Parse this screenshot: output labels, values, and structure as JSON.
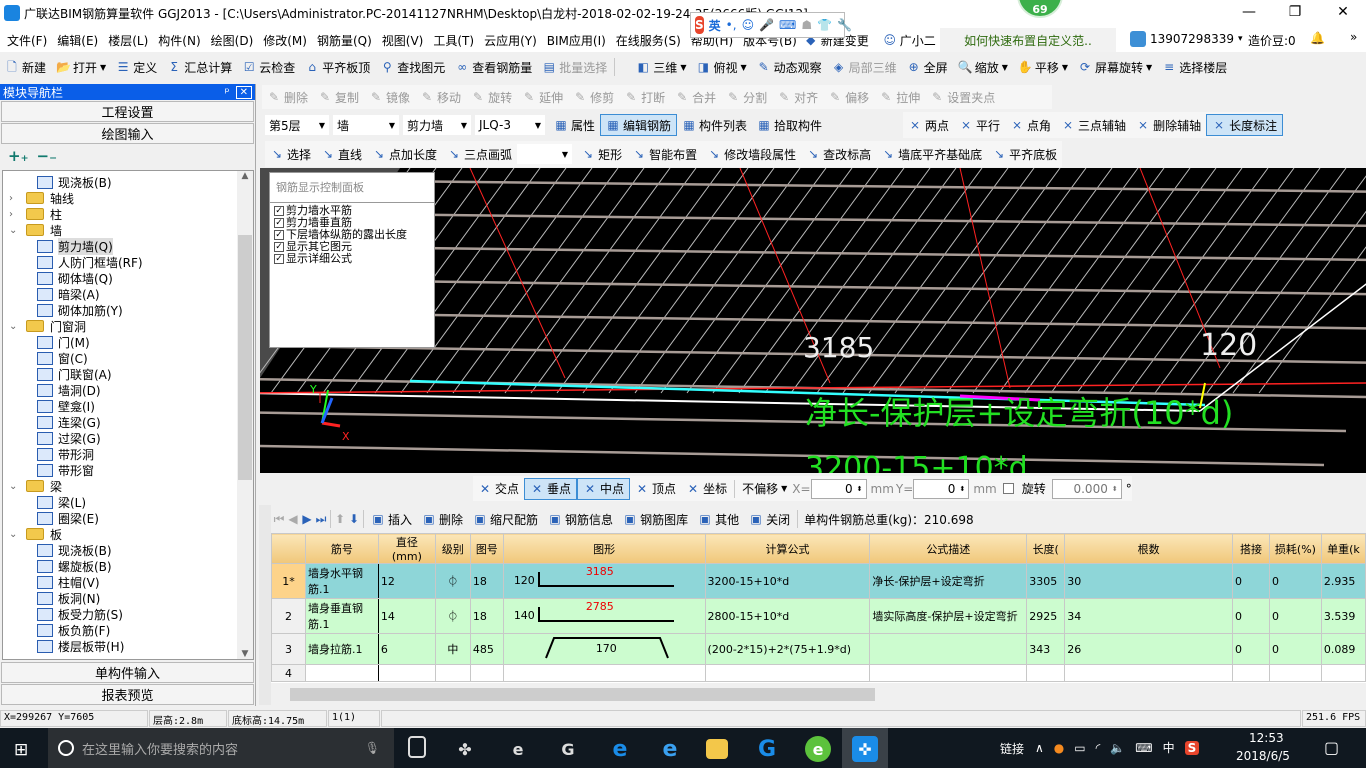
{
  "titlebar": {
    "title": "广联达BIM钢筋算量软件 GGJ2013 - [C:\\Users\\Administrator.PC-20141127NRHM\\Desktop\\白龙村-2018-02-02-19-24-35(2666版).GGJ12]",
    "badge": "69",
    "minimize": "—",
    "restore": "❐",
    "close": "✕"
  },
  "ime": {
    "logo": "S",
    "mode": "英",
    "punct": "•,",
    "icons": [
      "emoji-icon",
      "mic-icon",
      "keyboard-icon",
      "user-icon",
      "shirt-icon",
      "wrench-icon"
    ]
  },
  "menubar": {
    "items": [
      "文件(F)",
      "编辑(E)",
      "楼层(L)",
      "构件(N)",
      "绘图(D)",
      "修改(M)",
      "钢筋量(Q)",
      "视图(V)",
      "工具(T)",
      "云应用(Y)",
      "BIM应用(I)",
      "在线服务(S)",
      "帮助(H)",
      "版本号(B)"
    ],
    "new_change": "新建变更",
    "assistant": "广小二",
    "hint": "如何快速布置自定义范..",
    "account": "13907298339",
    "beans": "造价豆:0",
    "more": "»"
  },
  "toolbar1": {
    "items": [
      {
        "label": "新建",
        "icon": "new-file-icon"
      },
      {
        "label": "打开",
        "icon": "open-folder-icon",
        "dropdown": true
      },
      {
        "label": "定义",
        "icon": "define-icon"
      },
      {
        "label": "汇总计算",
        "icon": "sigma-icon"
      },
      {
        "label": "云检查",
        "icon": "cloud-check-icon"
      },
      {
        "label": "平齐板顶",
        "icon": "align-top-icon"
      },
      {
        "label": "查找图元",
        "icon": "binoculars-icon"
      },
      {
        "label": "查看钢筋量",
        "icon": "glasses-icon"
      },
      {
        "label": "批量选择",
        "icon": "batch-select-icon",
        "disabled": true
      }
    ],
    "view_items": [
      {
        "label": "三维",
        "icon": "cube-icon",
        "dropdown": true
      },
      {
        "label": "俯视",
        "icon": "top-view-icon",
        "dropdown": true
      },
      {
        "label": "动态观察",
        "icon": "orbit-icon"
      },
      {
        "label": "局部三维",
        "icon": "local-3d-icon",
        "disabled": true
      },
      {
        "label": "全屏",
        "icon": "fullscreen-icon"
      },
      {
        "label": "缩放",
        "icon": "zoom-icon",
        "dropdown": true
      },
      {
        "label": "平移",
        "icon": "pan-hand-icon",
        "dropdown": true
      },
      {
        "label": "屏幕旋转",
        "icon": "rotate-screen-icon",
        "dropdown": true
      },
      {
        "label": "选择楼层",
        "icon": "floor-select-icon"
      }
    ]
  },
  "edit_toolbar": {
    "items": [
      "删除",
      "复制",
      "镜像",
      "移动",
      "旋转",
      "延伸",
      "修剪",
      "打断",
      "合并",
      "分割",
      "对齐",
      "偏移",
      "拉伸",
      "设置夹点"
    ]
  },
  "component_toolbar": {
    "floor": "第5层",
    "type": "墙",
    "subtype": "剪力墙",
    "name": "JLQ-3",
    "items": [
      "属性",
      "编辑钢筋",
      "构件列表",
      "拾取构件"
    ],
    "active": "编辑钢筋"
  },
  "axis_toolbar": {
    "items": [
      "两点",
      "平行",
      "点角",
      "三点辅轴",
      "删除辅轴",
      "长度标注"
    ],
    "active": "长度标注"
  },
  "draw_toolbar": {
    "items": [
      "选择",
      "直线",
      "点加长度",
      "三点画弧",
      "",
      "矩形",
      "智能布置",
      "修改墙段属性",
      "查改标高",
      "墙底平齐基础底",
      "平齐底板"
    ]
  },
  "nav": {
    "title": "模块导航栏",
    "pin": "ᵖ",
    "close": "✕",
    "project_settings": "工程设置",
    "drawing_input": "绘图输入",
    "expand": "+₊",
    "collapse": "−₋",
    "single_input": "单构件输入",
    "report_preview": "报表预览",
    "tree": [
      {
        "label": "现浇板(B)",
        "level": 2
      },
      {
        "label": "轴线",
        "level": 1,
        "folder": true,
        "open": false
      },
      {
        "label": "柱",
        "level": 1,
        "folder": true,
        "open": false
      },
      {
        "label": "墙",
        "level": 1,
        "folder": true,
        "open": true
      },
      {
        "label": "剪力墙(Q)",
        "level": 2,
        "selected": true
      },
      {
        "label": "人防门框墙(RF)",
        "level": 2
      },
      {
        "label": "砌体墙(Q)",
        "level": 2
      },
      {
        "label": "暗梁(A)",
        "level": 2
      },
      {
        "label": "砌体加筋(Y)",
        "level": 2
      },
      {
        "label": "门窗洞",
        "level": 1,
        "folder": true,
        "open": true
      },
      {
        "label": "门(M)",
        "level": 2
      },
      {
        "label": "窗(C)",
        "level": 2
      },
      {
        "label": "门联窗(A)",
        "level": 2
      },
      {
        "label": "墙洞(D)",
        "level": 2
      },
      {
        "label": "壁龛(I)",
        "level": 2
      },
      {
        "label": "连梁(G)",
        "level": 2
      },
      {
        "label": "过梁(G)",
        "level": 2
      },
      {
        "label": "带形洞",
        "level": 2
      },
      {
        "label": "带形窗",
        "level": 2
      },
      {
        "label": "梁",
        "level": 1,
        "folder": true,
        "open": true
      },
      {
        "label": "梁(L)",
        "level": 2
      },
      {
        "label": "圈梁(E)",
        "level": 2
      },
      {
        "label": "板",
        "level": 1,
        "folder": true,
        "open": true
      },
      {
        "label": "现浇板(B)",
        "level": 2
      },
      {
        "label": "螺旋板(B)",
        "level": 2
      },
      {
        "label": "柱帽(V)",
        "level": 2
      },
      {
        "label": "板洞(N)",
        "level": 2
      },
      {
        "label": "板受力筋(S)",
        "level": 2
      },
      {
        "label": "板负筋(F)",
        "level": 2
      },
      {
        "label": "楼层板带(H)",
        "level": 2
      }
    ]
  },
  "viewport": {
    "panel_title": "钢筋显示控制面板",
    "checks": [
      {
        "label": "剪力墙水平筋",
        "checked": true
      },
      {
        "label": "剪力墙垂直筋",
        "checked": true
      },
      {
        "label": "下层墙体纵筋的露出长度",
        "checked": true
      },
      {
        "label": "显示其它图元",
        "checked": true
      },
      {
        "label": "显示详细公式",
        "checked": true
      }
    ],
    "dim1": "3185",
    "dim2": "120",
    "formula_desc": "净长-保护层+设定弯折(10*d)",
    "formula": "3200-15+10*d",
    "partial_label": "OO",
    "axis_x": "X",
    "axis_y": "Y",
    "axis_z": "Z"
  },
  "snap_toolbar": {
    "items": [
      "交点",
      "垂点",
      "中点",
      "顶点",
      "坐标"
    ],
    "active": [
      "垂点",
      "中点"
    ],
    "offset_mode": "不偏移",
    "x_label": "X=",
    "x_value": "0",
    "y_label": "Y=",
    "y_value": "0",
    "unit": "mm",
    "rotate_label": "旋转",
    "rotate_value": "0.000",
    "degree": "°"
  },
  "rebar_toolbar": {
    "items": [
      "插入",
      "删除",
      "缩尺配筋",
      "钢筋信息",
      "钢筋图库",
      "其他",
      "关闭"
    ],
    "total": "单构件钢筋总重(kg)：210.698"
  },
  "rebar_table": {
    "columns": [
      "",
      "筋号",
      "直径(mm)",
      "级别",
      "图号",
      "图形",
      "计算公式",
      "公式描述",
      "长度(",
      "根数",
      "搭接",
      "损耗(%)",
      "单重(k"
    ],
    "rows": [
      {
        "no": "1*",
        "name": "墙身水平钢筋.1",
        "dia": "12",
        "grade": "⏀",
        "fig": "18",
        "shape_left": "120",
        "shape_len": "3185",
        "formula": "3200-15+10*d",
        "desc": "净长-保护层+设定弯折",
        "length": "3305",
        "count": "30",
        "lap": "0",
        "loss": "0",
        "unit_weight": "2.935"
      },
      {
        "no": "2",
        "name": "墙身垂直钢筋.1",
        "dia": "14",
        "grade": "⏀",
        "fig": "18",
        "shape_left": "140",
        "shape_len": "2785",
        "formula": "2800-15+10*d",
        "desc": "墙实际高度-保护层+设定弯折",
        "length": "2925",
        "count": "34",
        "lap": "0",
        "loss": "0",
        "unit_weight": "3.539"
      },
      {
        "no": "3",
        "name": "墙身拉筋.1",
        "dia": "6",
        "grade": "中",
        "fig": "485",
        "shape_left": "",
        "shape_len": "170",
        "formula": "(200-2*15)+2*(75+1.9*d)",
        "desc": "",
        "length": "343",
        "count": "26",
        "lap": "0",
        "loss": "0",
        "unit_weight": "0.089"
      },
      {
        "no": "4",
        "name": "",
        "dia": "",
        "grade": "",
        "fig": "",
        "shape_left": "",
        "shape_len": "",
        "formula": "",
        "desc": "",
        "length": "",
        "count": "",
        "lap": "",
        "loss": "",
        "unit_weight": ""
      }
    ]
  },
  "status": {
    "coords": "X=299267 Y=7605",
    "floor_height": "层高:2.8m",
    "base_elev": "底标高:14.75m",
    "count": "1(1)",
    "fps": "251.6 FPS"
  },
  "taskbar": {
    "search_placeholder": "在这里输入你要搜索的内容",
    "tray_link": "链接",
    "lang": "中",
    "time": "12:53",
    "date": "2018/6/5"
  },
  "colors": {
    "nav_header": "#0a5ee8",
    "row_selected": "#8ed6d8",
    "row_normal": "#ccfccf",
    "header_gold": "#f0c77a",
    "viewport_bg": "#000000",
    "formula_green": "#22e022"
  }
}
